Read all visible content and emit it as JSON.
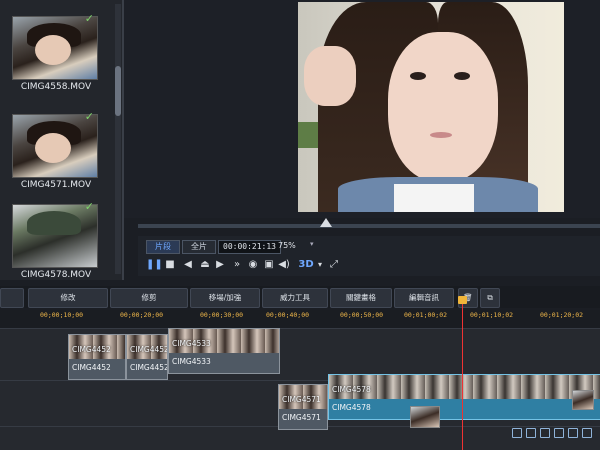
{
  "library": {
    "clips": [
      {
        "name": "CIMG4558.MOV"
      },
      {
        "name": "CIMG4571.MOV"
      },
      {
        "name": "CIMG4578.MOV"
      }
    ],
    "check_icon": "✓"
  },
  "controls": {
    "tab_clip": "片段",
    "tab_full": "全片",
    "timecode": "00:00:21:13",
    "zoom": "75%",
    "three_d": "3D"
  },
  "actions": {
    "edit": "修改",
    "trim": "修剪",
    "transition": "移場/加強",
    "power_tools": "威力工具",
    "keyframe": "關鍵畫格",
    "sound_track": "編輯音訊"
  },
  "ruler": {
    "ticks": [
      "00;00;10;00",
      "00;00;20;00",
      "00;00;30;00",
      "00;00;40;00",
      "00;00;50;00",
      "00;01;00;02",
      "00;01;10;02",
      "00;01;20;02"
    ]
  },
  "timeline": {
    "clips_row1": [
      {
        "top": "CIMG4452",
        "bottom": "CIMG4452"
      },
      {
        "top": "CIMG4452",
        "bottom": "CIMG4452"
      },
      {
        "top": "CIMG4533",
        "bottom": "CIMG4533"
      }
    ],
    "clips_row2": [
      {
        "top": "CIMG4571",
        "bottom": "CIMG4571"
      },
      {
        "top": "CIMG4578",
        "bottom": "CIMG4578"
      }
    ]
  }
}
